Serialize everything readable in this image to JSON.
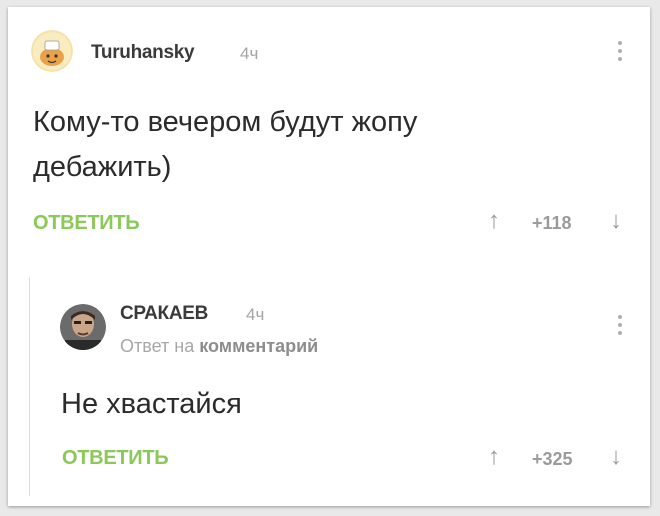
{
  "comment": {
    "author": "Turuhansky",
    "time": "4ч",
    "text_line1": "Кому-то вечером будут жопу",
    "text_line2": "дебажить)",
    "reply_label": "ОТВЕТИТЬ",
    "rating": "+118",
    "vote_up": "↑",
    "vote_down": "↓"
  },
  "reply": {
    "author": "СРАКАЕВ",
    "time": "4ч",
    "reply_to_prefix": "Ответ на",
    "reply_to_link": "комментарий",
    "text": "Не хвастайся",
    "reply_label": "ОТВЕТИТЬ",
    "rating": "+325",
    "vote_up": "↑",
    "vote_down": "↓"
  },
  "colors": {
    "accent_green": "#8ac858",
    "meta_gray": "#a5a5a5"
  }
}
